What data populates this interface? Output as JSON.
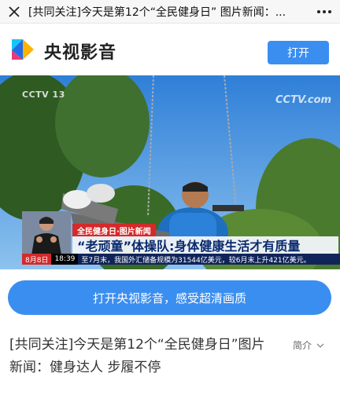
{
  "topbar": {
    "title": "[共同关注]今天是第12个“全民健身日” 图片新闻：...",
    "close_icon": "close-icon",
    "more_icon": "more-dots-icon"
  },
  "app": {
    "name": "央视影音",
    "open_label": "打开",
    "logo_colors": [
      "#18c5f5",
      "#ffb300",
      "#e63b7a",
      "#1f6ee8"
    ]
  },
  "video": {
    "watermark_left": "CCTV 13",
    "watermark_right": "CCTV.com",
    "tag": "全民健身日·图片新闻",
    "headline": "“老顽童”体操队:身体健康生活才有质量",
    "ticker_date": "8月8日",
    "ticker_time": "18:39",
    "ticker_text": "至7月末，我国外汇储备规模为31544亿美元，较6月末上升421亿美元。"
  },
  "cta": {
    "label": "打开央视影音，感受超清画质"
  },
  "article": {
    "headline": "[共同关注]今天是第12个“全民健身日”图片新闻：健身达人 步履不停",
    "intro_label": "简介",
    "intro_icon": "chevron-down-icon"
  }
}
